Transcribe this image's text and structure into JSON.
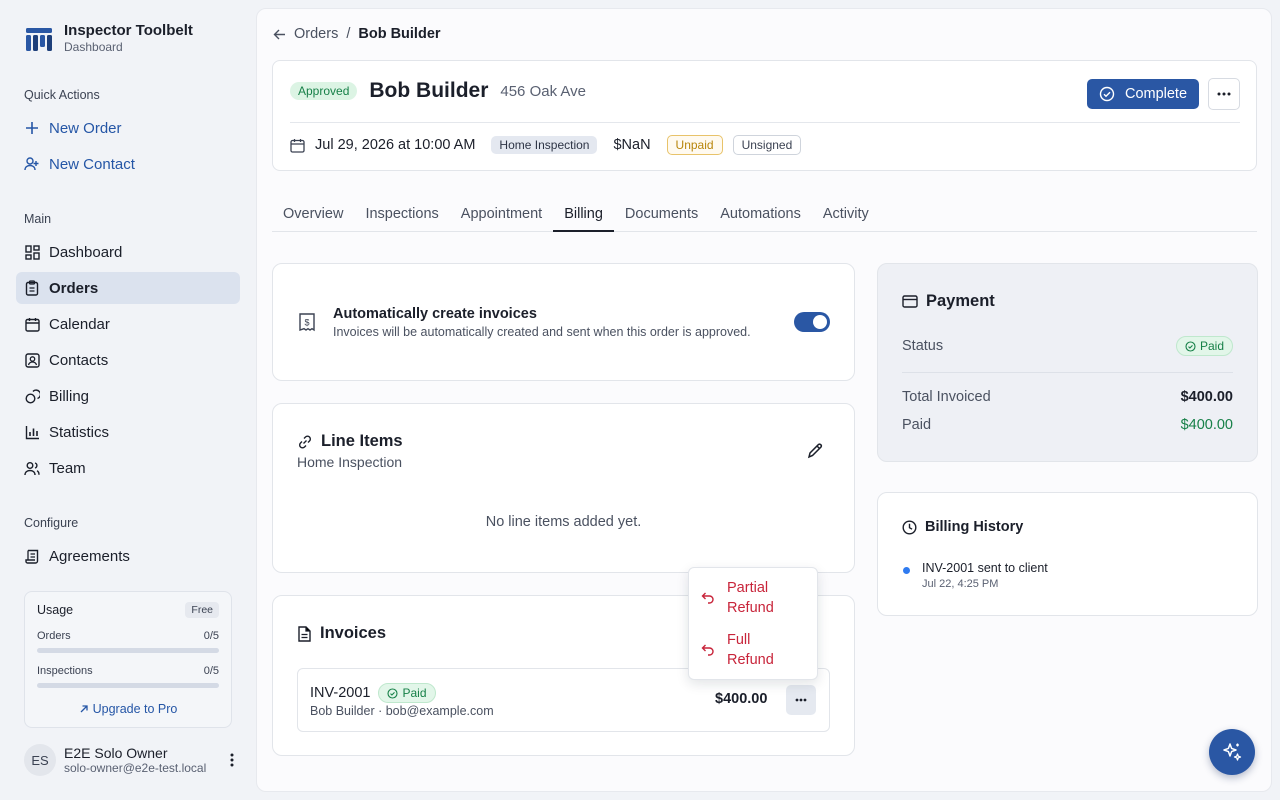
{
  "brand": {
    "title": "Inspector Toolbelt",
    "subtitle": "Dashboard"
  },
  "sidebar": {
    "quick_actions_label": "Quick Actions",
    "quick_actions": [
      {
        "label": "New Order",
        "icon": "plus-icon"
      },
      {
        "label": "New Contact",
        "icon": "user-plus-icon"
      }
    ],
    "main_label": "Main",
    "main_items": [
      {
        "label": "Dashboard",
        "icon": "dashboard-icon"
      },
      {
        "label": "Orders",
        "icon": "clipboard-icon",
        "active": true
      },
      {
        "label": "Calendar",
        "icon": "calendar-icon"
      },
      {
        "label": "Contacts",
        "icon": "contact-card-icon"
      },
      {
        "label": "Billing",
        "icon": "coins-icon"
      },
      {
        "label": "Statistics",
        "icon": "bar-chart-icon"
      },
      {
        "label": "Team",
        "icon": "team-icon"
      }
    ],
    "configure_label": "Configure",
    "configure_items": [
      {
        "label": "Agreements",
        "icon": "scroll-icon"
      }
    ]
  },
  "usage": {
    "title": "Usage",
    "plan": "Free",
    "rows": [
      {
        "label": "Orders",
        "value": "0/5",
        "fraction": 0
      },
      {
        "label": "Inspections",
        "value": "0/5",
        "fraction": 0
      }
    ],
    "upgrade_label": "Upgrade to Pro"
  },
  "user": {
    "initials": "ES",
    "name": "E2E Solo Owner",
    "email": "solo-owner@e2e-test.local"
  },
  "breadcrumb": {
    "parent": "Orders",
    "separator": "/",
    "current": "Bob Builder"
  },
  "order": {
    "status": "Approved",
    "customer": "Bob Builder",
    "address": "456 Oak Ave",
    "complete_label": "Complete",
    "datetime": "Jul 29, 2026 at 10:00 AM",
    "type": "Home Inspection",
    "amount": "$NaN",
    "payment_badge": "Unpaid",
    "signature_badge": "Unsigned"
  },
  "tabs": [
    "Overview",
    "Inspections",
    "Appointment",
    "Billing",
    "Documents",
    "Automations",
    "Activity"
  ],
  "active_tab": "Billing",
  "auto_invoice": {
    "title": "Automatically create invoices",
    "description": "Invoices will be automatically created and sent when this order is approved.",
    "enabled": true
  },
  "line_items": {
    "title": "Line Items",
    "subtitle": "Home Inspection",
    "empty_text": "No line items added yet."
  },
  "invoices": {
    "title": "Invoices",
    "items": [
      {
        "id": "INV-2001",
        "status": "Paid",
        "meta": "Bob Builder · bob@example.com",
        "amount": "$400.00"
      }
    ]
  },
  "refund_menu": {
    "items": [
      "Partial Refund",
      "Full Refund"
    ]
  },
  "payment": {
    "title": "Payment",
    "status_label": "Status",
    "status_value": "Paid",
    "total_label": "Total Invoiced",
    "total_value": "$400.00",
    "paid_label": "Paid",
    "paid_value": "$400.00"
  },
  "billing_history": {
    "title": "Billing History",
    "entries": [
      {
        "text": "INV-2001 sent to client",
        "time": "Jul 22, 4:25 PM"
      }
    ]
  },
  "colors": {
    "accent": "#2a57a4",
    "success": "#178048",
    "danger": "#c8243a",
    "warning": "#b8860b"
  }
}
